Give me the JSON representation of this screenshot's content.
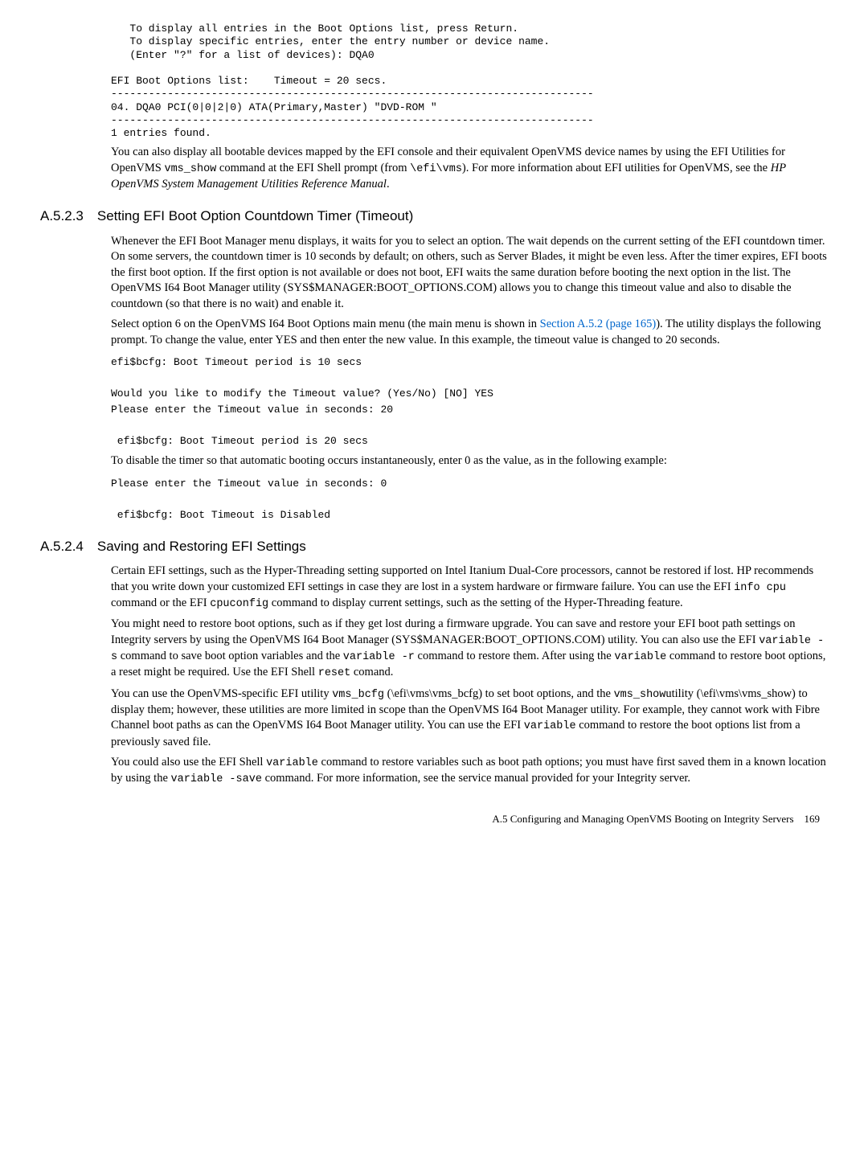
{
  "code1": "   To display all entries in the Boot Options list, press Return.\n   To display specific entries, enter the entry number or device name.\n   (Enter \"?\" for a list of devices): DQA0\n\nEFI Boot Options list:    Timeout = 20 secs.\n-----------------------------------------------------------------------------\n04. DQA0 PCI(0|0|2|0) ATA(Primary,Master) \"DVD-ROM \"\n-----------------------------------------------------------------------------\n1 entries found.",
  "para1a": "You can also display all bootable devices mapped by the EFI console and their equivalent OpenVMS device names by using the EFI Utilities for OpenVMS ",
  "para1b": "vms_show",
  "para1c": " command at the EFI Shell prompt (from ",
  "para1d": "\\efi\\vms",
  "para1e": "). For more information about EFI utilities for OpenVMS, see the ",
  "para1f": "HP OpenVMS System Management Utilities Reference Manual",
  "para1g": ".",
  "h1": "A.5.2.3 Setting EFI Boot Option Countdown Timer (Timeout)",
  "para2": "Whenever the EFI Boot Manager menu displays, it waits for you to select an option. The wait depends on the current setting of the EFI countdown timer. On some servers, the countdown timer is 10 seconds by default; on others, such as Server Blades, it might be even less. After the timer expires, EFI boots the first boot option. If the first option is not available or does not boot, EFI waits the same duration before booting the next option in the list. The OpenVMS I64 Boot Manager utility (SYS$MANAGER:BOOT_OPTIONS.COM) allows you to change this timeout value and also to disable the countdown (so that there is no wait) and enable it.",
  "para3a": "Select option 6 on the OpenVMS I64 Boot Options main menu (the main menu is shown in ",
  "para3link": "Section A.5.2 (page 165)",
  "para3b": "). The utility displays the following prompt. To change the value, enter YES and then enter the new value. In this example, the timeout value is changed to 20 seconds.",
  "code2": "efi$bcfg: Boot Timeout period is 10 secs\n\nWould you like to modify the Timeout value? (Yes/No) [NO] YES\nPlease enter the Timeout value in seconds: 20\n\n efi$bcfg: Boot Timeout period is 20 secs",
  "para4": "To disable the timer so that automatic booting occurs instantaneously, enter 0 as the value, as in the following example:",
  "code3": "Please enter the Timeout value in seconds: 0\n\n efi$bcfg: Boot Timeout is Disabled",
  "h2": "A.5.2.4 Saving and Restoring EFI Settings",
  "para5a": "Certain EFI settings, such as the Hyper-Threading setting supported on Intel Itanium Dual-Core processors, cannot be restored if lost. HP recommends that you write down your customized EFI settings in case they are lost in a system hardware or firmware failure. You can use the EFI ",
  "para5b": "info cpu",
  "para5c": " command or the EFI ",
  "para5d": "cpuconfig",
  "para5e": " command to display current settings, such as the setting of the Hyper-Threading feature.",
  "para6a": "You might need to restore boot options, such as if they get lost during a firmware upgrade. You can save and restore your EFI boot path settings on Integrity servers by using the OpenVMS I64 Boot Manager (SYS$MANAGER:BOOT_OPTIONS.COM) utility. You can also use the EFI ",
  "para6b": "variable -s",
  "para6c": " command to save boot option variables and the ",
  "para6d": "variable -r",
  "para6e": " command to restore them. After using the ",
  "para6f": "variable",
  "para6g": " command to restore boot options, a reset might be required. Use the EFI Shell ",
  "para6h": "reset",
  "para6i": " comand.",
  "para7a": "You can use the OpenVMS-specific EFI utility ",
  "para7b": "vms_bcfg",
  "para7c": " (\\efi\\vms\\vms_bcfg) to set boot options, and the ",
  "para7d": "vms_show",
  "para7e": "utility (\\efi\\vms\\vms_show) to display them; however, these utilities are more limited in scope than the OpenVMS I64 Boot Manager utility. For example, they cannot work with Fibre Channel boot paths as can the OpenVMS I64 Boot Manager utility. You can use the EFI ",
  "para7f": "variable",
  "para7g": " command to restore the boot options list from a previously saved file.",
  "para8a": "You could also use the EFI Shell ",
  "para8b": "variable",
  "para8c": " command to restore variables such as boot path options; you must have first saved them in a known location by using the ",
  "para8d": "variable -save",
  "para8e": " command. For more information, see the service manual provided for your Integrity server.",
  "footer": "A.5 Configuring and Managing OpenVMS Booting on Integrity Servers 169"
}
